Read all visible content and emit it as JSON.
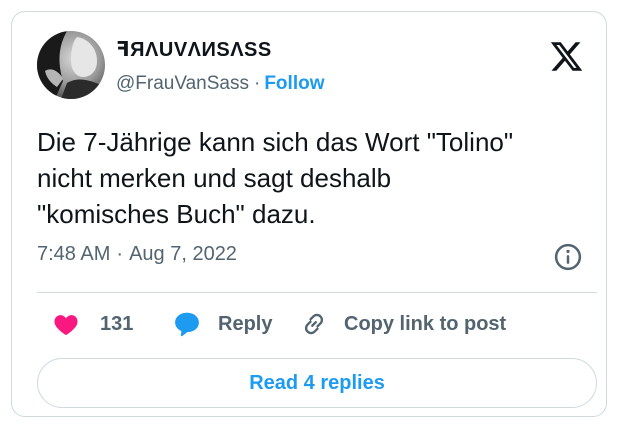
{
  "author": {
    "display_name": "ꟻЯΛUVΛИSΛSS",
    "handle": "@FrauVanSass",
    "separator": "·",
    "follow_label": "Follow"
  },
  "tweet": {
    "text": "Die 7-Jährige kann sich das Wort \"Tolino\"\nnicht merken und sagt deshalb\n\"komisches Buch\" dazu.",
    "time": "7:48 AM",
    "separator": "·",
    "date": "Aug 7, 2022"
  },
  "actions": {
    "like_count": "131",
    "reply_label": "Reply",
    "copy_label": "Copy link to post"
  },
  "footer": {
    "read_replies_label": "Read 4 replies"
  },
  "icons": {
    "platform_logo": "x-logo-icon",
    "info": "info-icon",
    "like": "heart-icon",
    "reply": "reply-bubble-icon",
    "copy": "link-icon"
  },
  "colors": {
    "accent": "#1d9bf0",
    "heart": "#f91880",
    "muted_text": "#536471",
    "border": "#cfd9de"
  }
}
